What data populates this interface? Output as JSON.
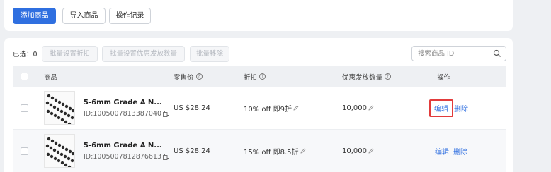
{
  "toolbar": {
    "add_product": "添加商品",
    "import_product": "导入商品",
    "operation_log": "操作记录"
  },
  "batch": {
    "selected_label": "已选：0",
    "set_discount": "批量设置折扣",
    "set_quantity": "批量设置优惠发放数量",
    "remove": "批量移除"
  },
  "search": {
    "placeholder": "搜索商品 ID"
  },
  "table": {
    "columns": {
      "product": "商品",
      "price": "零售价",
      "discount": "折扣",
      "quantity": "优惠发放数量",
      "actions": "操作"
    },
    "rows": [
      {
        "name": "5-6mm Grade A N...",
        "id": "ID:1005007813387040",
        "price": "US $28.24",
        "discount": "10% off 即9折",
        "quantity": "10,000",
        "edit": "编辑",
        "delete": "删除"
      },
      {
        "name": "5-6mm Grade A N...",
        "id": "ID:1005007812876613",
        "price": "US $28.24",
        "discount": "15% off 即8.5折",
        "quantity": "10,000",
        "edit": "编辑",
        "delete": "删除"
      }
    ]
  },
  "colors": {
    "primary": "#2f6fe0",
    "highlight": "#e23b3b"
  },
  "icons": [
    "search-icon",
    "copy-icon",
    "edit-pen-icon",
    "help-icon"
  ]
}
